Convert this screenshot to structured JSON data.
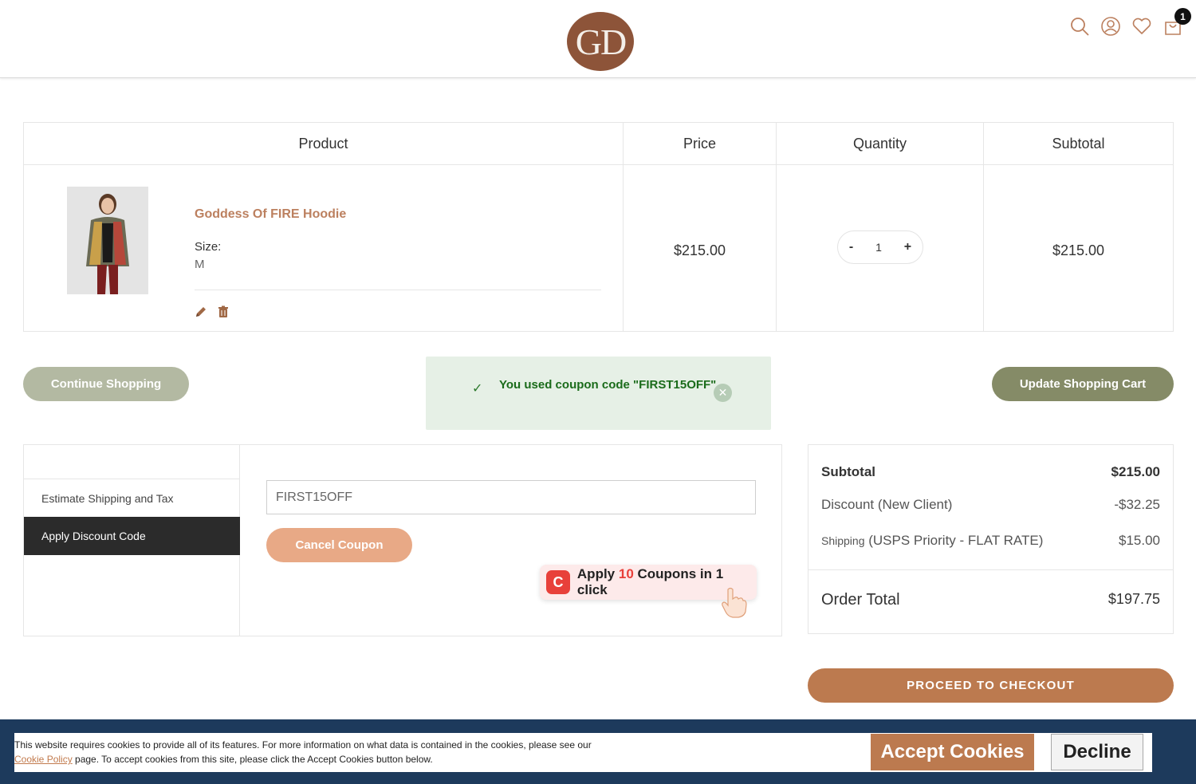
{
  "header": {
    "logo_text": "GD",
    "icons": [
      "search-icon",
      "user-icon",
      "heart-icon",
      "cart-icon"
    ],
    "cart_count": "1",
    "brand_color": "#8d5439"
  },
  "cart_table": {
    "headers": {
      "product": "Product",
      "price": "Price",
      "quantity": "Quantity",
      "subtotal": "Subtotal"
    },
    "item": {
      "name": "Goddess Of FIRE Hoodie",
      "size_label": "Size:",
      "size_value": "M",
      "price": "$215.00",
      "quantity": "1",
      "qty_minus": "-",
      "qty_plus": "+",
      "subtotal": "$215.00"
    }
  },
  "actions": {
    "continue_label": "Continue Shopping",
    "update_label": "Update Shopping Cart"
  },
  "coupon_message": {
    "check": "✓",
    "text": "You used coupon code \"FIRST15OFF\".",
    "close": "✕"
  },
  "discount": {
    "tab_shipping": "Estimate Shipping and Tax",
    "tab_discount": "Apply Discount Code",
    "code_value": "FIRST15OFF",
    "cancel_label": "Cancel Coupon"
  },
  "extension_popup": {
    "logo": "C",
    "prefix": "Apply ",
    "count": "10",
    "suffix": " Coupons in 1 click"
  },
  "summary": {
    "subtotal_label": "Subtotal",
    "subtotal_value": "$215.00",
    "discount_label": "Discount (New Client)",
    "discount_value": "-$32.25",
    "shipping_label_small": "Shipping",
    "shipping_label_rest": " (USPS Priority - FLAT RATE)",
    "shipping_value": "$15.00",
    "total_label": "Order Total",
    "total_value": "$197.75"
  },
  "checkout_label": "PROCEED TO CHECKOUT",
  "cookie": {
    "text_1": "This website requires cookies to provide all of its features. For more information on what data is contained in the cookies, please see our",
    "policy_link": "Cookie Policy",
    "text_2": " page. To accept cookies from this site, please click the Accept Cookies button below.",
    "accept_label": "Accept Cookies",
    "decline_label": "Decline"
  }
}
